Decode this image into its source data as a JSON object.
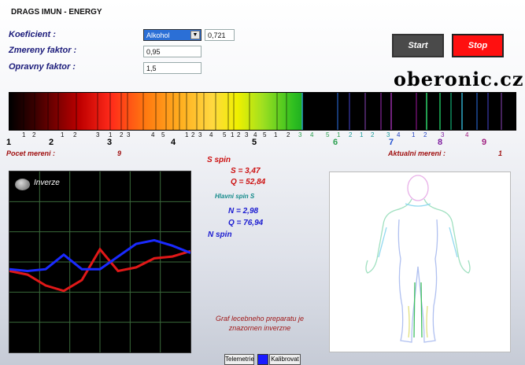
{
  "app": {
    "title": "DRAGS IMUN - ENERGY",
    "brand": "oberonic.cz"
  },
  "form": {
    "koeficient_label": "Koeficient :",
    "koeficient_select": "Alkohol",
    "koeficient_value": "0,721",
    "zmereny_label": "Zmereny faktor :",
    "zmereny_value": "0,95",
    "opravny_label": "Opravny faktor :",
    "opravny_value": "1,5"
  },
  "buttons": {
    "start": "Start",
    "stop": "Stop",
    "telemetrie": "Telemetrie",
    "kalibrovat": "Kalibrovat"
  },
  "colors": {
    "start_bg": "#4a4a4a",
    "stop_bg": "#ff1010",
    "swatch": "#1a1aff"
  },
  "scale": {
    "sub_labels": [
      "1",
      "2",
      "1",
      "2",
      "3",
      "1",
      "2",
      "3",
      "4",
      "5",
      "1",
      "2",
      "3",
      "4",
      "5",
      "1",
      "2",
      "3",
      "4",
      "5",
      "1",
      "2",
      "3",
      "4",
      "5",
      "1",
      "2",
      "1",
      "2",
      "3",
      "4",
      "1",
      "2",
      "3",
      "4"
    ],
    "major_labels": [
      "1",
      "2",
      "3",
      "4",
      "5",
      "6",
      "7",
      "8",
      "9"
    ]
  },
  "counters": {
    "pocet_label": "Pocet mereni :",
    "pocet_value": "9",
    "aktualni_label": "Aktualni mereni :",
    "aktualni_value": "1"
  },
  "graph": {
    "inverze_label": "Inverze",
    "red_series": [
      0.55,
      0.57,
      0.63,
      0.66,
      0.6,
      0.43,
      0.55,
      0.53,
      0.48,
      0.47,
      0.44
    ],
    "blue_series": [
      0.54,
      0.55,
      0.54,
      0.46,
      0.54,
      0.54,
      0.47,
      0.4,
      0.38,
      0.41,
      0.45
    ]
  },
  "readouts": {
    "s_spin": "S spin",
    "s_value": "S = 3,47",
    "q1_value": "Q = 52,84",
    "hlavni": "Hlavni spin S",
    "n_value": "N = 2,98",
    "q2_value": "Q = 76,94",
    "n_spin": "N spin",
    "note_line1": "Graf lecebneho preparatu je",
    "note_line2": "znazornen inverzne"
  }
}
